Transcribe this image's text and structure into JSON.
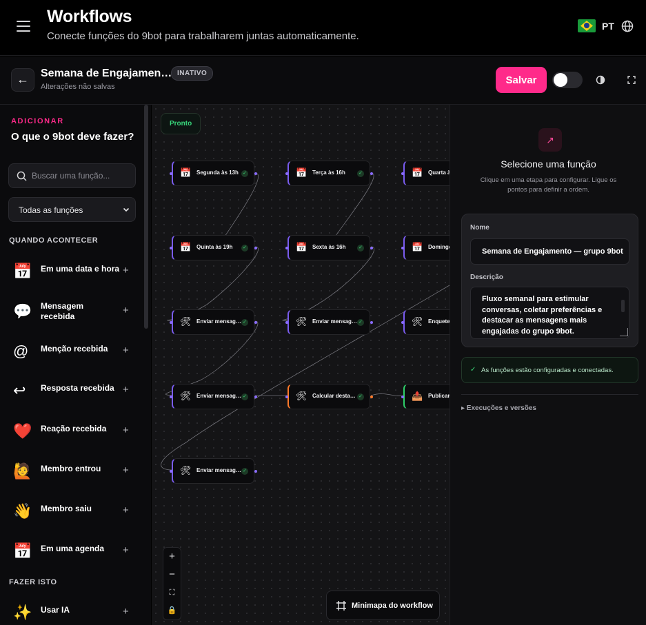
{
  "header": {
    "title": "Workflows",
    "subtitle": "Conecte funções do 9bot para trabalharem juntas automaticamente.",
    "language": "PT"
  },
  "workflow": {
    "name": "Semana de Engajamen…",
    "status": "INATIVO",
    "unsaved": "Alterações não salvas",
    "save_label": "Salvar"
  },
  "sidebar": {
    "add_label": "ADICIONAR",
    "add_title": "O que o 9bot deve fazer?",
    "search_placeholder": "Buscar uma função...",
    "filter_value": "Todas as funções",
    "when_header": "QUANDO ACONTECER",
    "do_header": "FAZER ISTO",
    "triggers": [
      {
        "icon": "calendar-icon",
        "glyph": "📅",
        "label": "Em uma data e hora"
      },
      {
        "icon": "speech-bubble-icon",
        "glyph": "💬",
        "label": "Mensagem recebida"
      },
      {
        "icon": "at-sign-icon",
        "glyph": "@",
        "label": "Menção recebida"
      },
      {
        "icon": "reply-arrow-icon",
        "glyph": "↩",
        "label": "Resposta recebida"
      },
      {
        "icon": "heart-icon",
        "glyph": "❤️",
        "label": "Reação recebida"
      },
      {
        "icon": "raising-hand-icon",
        "glyph": "🙋",
        "label": "Membro entrou"
      },
      {
        "icon": "waving-hand-icon",
        "glyph": "👋",
        "label": "Membro saiu"
      },
      {
        "icon": "calendar-icon",
        "glyph": "📅",
        "label": "Em uma agenda"
      }
    ],
    "actions": [
      {
        "icon": "sparkles-icon",
        "glyph": "✨",
        "label": "Usar IA"
      }
    ]
  },
  "canvas": {
    "ready_label": "Pronto",
    "minimap_label": "Minimapa do workflow",
    "nodes": [
      {
        "id": "n1",
        "label": "Segunda às 13h",
        "icon": "calendar-icon",
        "glyph": "📅",
        "variant": "purple"
      },
      {
        "id": "n2",
        "label": "Terça às 16h",
        "icon": "calendar-icon",
        "glyph": "📅",
        "variant": "purple"
      },
      {
        "id": "n3",
        "label": "Quarta às",
        "icon": "calendar-icon",
        "glyph": "📅",
        "variant": "purple"
      },
      {
        "id": "n4",
        "label": "Quinta às 19h",
        "icon": "calendar-icon",
        "glyph": "📅",
        "variant": "purple"
      },
      {
        "id": "n5",
        "label": "Sexta às 16h",
        "icon": "calendar-icon",
        "glyph": "📅",
        "variant": "purple"
      },
      {
        "id": "n6",
        "label": "Domingo",
        "icon": "calendar-icon",
        "glyph": "📅",
        "variant": "purple"
      },
      {
        "id": "n7",
        "label": "Enviar mensag…",
        "icon": "tools-icon",
        "glyph": "🛠",
        "variant": "purple"
      },
      {
        "id": "n8",
        "label": "Enviar mensag…",
        "icon": "tools-icon",
        "glyph": "🛠",
        "variant": "purple"
      },
      {
        "id": "n9",
        "label": "Enquete",
        "icon": "tools-icon",
        "glyph": "🛠",
        "variant": "purple"
      },
      {
        "id": "n10",
        "label": "Enviar mensag…",
        "icon": "tools-icon",
        "glyph": "🛠",
        "variant": "purple"
      },
      {
        "id": "n11",
        "label": "Calcular desta…",
        "icon": "tools-icon",
        "glyph": "🛠",
        "variant": "orange"
      },
      {
        "id": "n12",
        "label": "Publicar",
        "icon": "upload-icon",
        "glyph": "📤",
        "variant": "green"
      },
      {
        "id": "n13",
        "label": "Enviar mensag…",
        "icon": "tools-icon",
        "glyph": "🛠",
        "variant": "purple"
      }
    ]
  },
  "panel": {
    "title": "Selecione uma função",
    "hint": "Clique em uma etapa para configurar. Ligue os pontos para definir a ordem.",
    "name_label": "Nome",
    "name_value": "Semana de Engajamento — grupo 9bot",
    "desc_label": "Descrição",
    "desc_value": "Fluxo semanal para estimular conversas, coletar preferências e destacar as mensagens mais engajadas do grupo 9bot.",
    "ok_text": "As funções estão configuradas e conectadas.",
    "exec_label": "▸ Execuções e versões"
  },
  "colors": {
    "accent": "#ff2a8a",
    "success": "#3ad477",
    "node_purple": "#7a5cf0",
    "node_orange": "#ff7a2a",
    "node_green": "#2fd06a"
  }
}
